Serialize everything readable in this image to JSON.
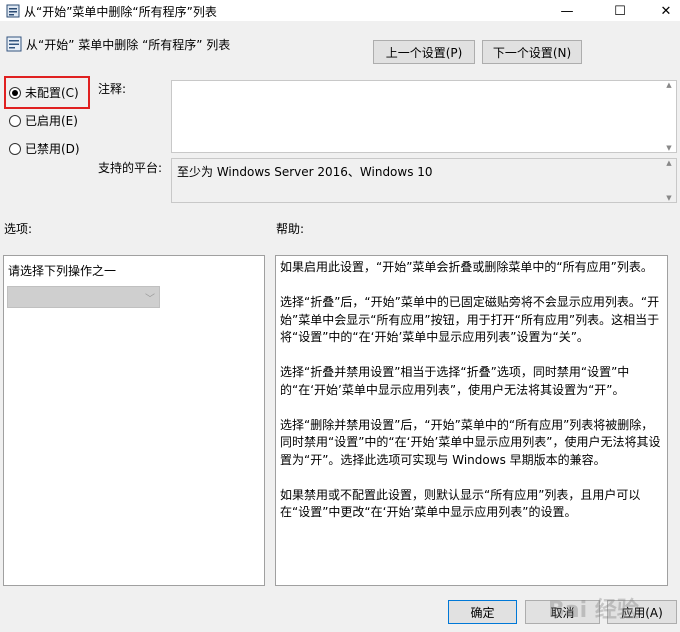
{
  "window": {
    "title": "从“开始”菜单中删除“所有程序”列表",
    "minimize": "—",
    "maximize": "☐",
    "close": "✕"
  },
  "header": {
    "title": "从“开始” 菜单中删除 “所有程序” 列表",
    "prev_button": "上一个设置(P)",
    "next_button": "下一个设置(N)"
  },
  "state": {
    "options": [
      {
        "label": "未配置(C)",
        "selected": true
      },
      {
        "label": "已启用(E)",
        "selected": false
      },
      {
        "label": "已禁用(D)",
        "selected": false
      }
    ]
  },
  "comment": {
    "label": "注释:",
    "value": ""
  },
  "platform": {
    "label": "支持的平台:",
    "value": "至少为 Windows Server 2016、Windows 10"
  },
  "options_section": {
    "label": "选项:",
    "prompt": "请选择下列操作之一",
    "dropdown_value": ""
  },
  "help_section": {
    "label": "帮助:",
    "paragraphs": [
      "如果启用此设置，“开始”菜单会折叠或删除菜单中的“所有应用”列表。",
      "选择“折叠”后，“开始”菜单中的已固定磁贴旁将不会显示应用列表。“开始”菜单中会显示“所有应用”按钮，用于打开“所有应用”列表。这相当于将“设置”中的“在‘开始’菜单中显示应用列表”设置为“关”。",
      "选择“折叠并禁用设置”相当于选择“折叠”选项，同时禁用“设置”中的“在‘开始’菜单中显示应用列表”，使用户无法将其设置为“开”。",
      "选择“删除并禁用设置”后，“开始”菜单中的“所有应用”列表将被删除，同时禁用“设置”中的“在‘开始’菜单中显示应用列表”，使用户无法将其设置为“开”。选择此选项可实现与 Windows 早期版本的兼容。",
      "如果禁用或不配置此设置，则默认显示“所有应用”列表，且用户可以在“设置”中更改“在‘开始’菜单中显示应用列表”的设置。"
    ]
  },
  "footer": {
    "ok": "确定",
    "cancel": "取消",
    "apply": "应用(A)"
  },
  "watermark": "Bai 经验",
  "colors": {
    "highlight": "#e02020",
    "dialog_bg": "#f0f0f0",
    "ok_border": "#0078d7"
  }
}
